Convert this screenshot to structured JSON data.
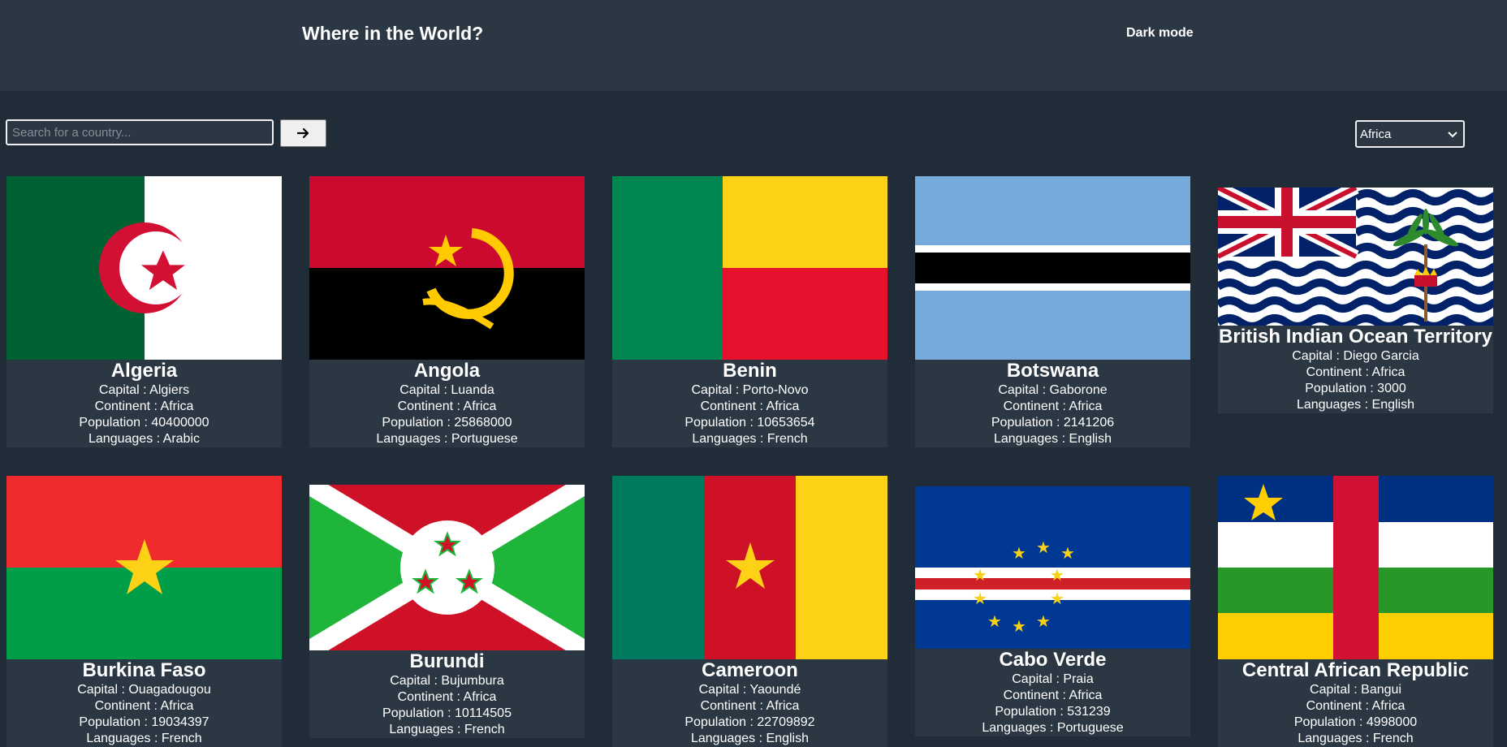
{
  "header": {
    "title": "Where in the World?",
    "dark_mode_label": "Dark mode"
  },
  "search": {
    "placeholder": "Search for a country...",
    "value": ""
  },
  "filter": {
    "selected": "Africa"
  },
  "labels": {
    "capital": "Capital : ",
    "continent": "Continent : ",
    "population": "Population : ",
    "languages": "Languages : "
  },
  "countries": [
    {
      "name": "Algeria",
      "capital": "Algiers",
      "continent": "Africa",
      "population": "40400000",
      "languages": "Arabic",
      "flag": "algeria-flag"
    },
    {
      "name": "Angola",
      "capital": "Luanda",
      "continent": "Africa",
      "population": "25868000",
      "languages": "Portuguese",
      "flag": "angola-flag"
    },
    {
      "name": "Benin",
      "capital": "Porto-Novo",
      "continent": "Africa",
      "population": "10653654",
      "languages": "French",
      "flag": "benin-flag"
    },
    {
      "name": "Botswana",
      "capital": "Gaborone",
      "continent": "Africa",
      "population": "2141206",
      "languages": "English",
      "flag": "botswana-flag"
    },
    {
      "name": "British Indian Ocean Territory",
      "capital": "Diego Garcia",
      "continent": "Africa",
      "population": "3000",
      "languages": "English",
      "flag": "british-indian-ocean-territory-flag"
    },
    {
      "name": "Burkina Faso",
      "capital": "Ouagadougou",
      "continent": "Africa",
      "population": "19034397",
      "languages": "French",
      "flag": "burkina-faso-flag"
    },
    {
      "name": "Burundi",
      "capital": "Bujumbura",
      "continent": "Africa",
      "population": "10114505",
      "languages": "French",
      "flag": "burundi-flag"
    },
    {
      "name": "Cameroon",
      "capital": "Yaoundé",
      "continent": "Africa",
      "population": "22709892",
      "languages": "English",
      "flag": "cameroon-flag"
    },
    {
      "name": "Cabo Verde",
      "capital": "Praia",
      "continent": "Africa",
      "population": "531239",
      "languages": "Portuguese",
      "flag": "cabo-verde-flag"
    },
    {
      "name": "Central African Republic",
      "capital": "Bangui",
      "continent": "Africa",
      "population": "4998000",
      "languages": "French",
      "flag": "central-african-republic-flag"
    }
  ],
  "colors": {
    "background": "#202c37",
    "element": "#2b3743",
    "text": "#ffffff"
  },
  "icons": {
    "search_button": "arrow-right-icon",
    "select": "chevron-down-icon"
  }
}
